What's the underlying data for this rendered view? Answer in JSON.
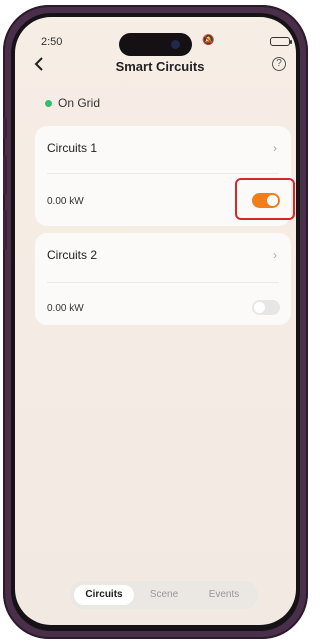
{
  "status_bar": {
    "time": "2:50",
    "icons": "silent wifi signal battery"
  },
  "header": {
    "title": "Smart Circuits",
    "back_icon": "chevron-left-icon",
    "help_icon": "question-circle-icon"
  },
  "grid_status": {
    "label": "On Grid",
    "color": "#2fbf71"
  },
  "circuits": [
    {
      "name": "Circuits 1",
      "power": "0.00 kW",
      "enabled": true
    },
    {
      "name": "Circuits 2",
      "power": "0.00 kW",
      "enabled": false
    }
  ],
  "tabs": [
    {
      "label": "Circuits",
      "active": true
    },
    {
      "label": "Scene",
      "active": false
    },
    {
      "label": "Events",
      "active": false
    }
  ],
  "colors": {
    "accent": "#f07f1b",
    "highlight": "#d8262b"
  }
}
